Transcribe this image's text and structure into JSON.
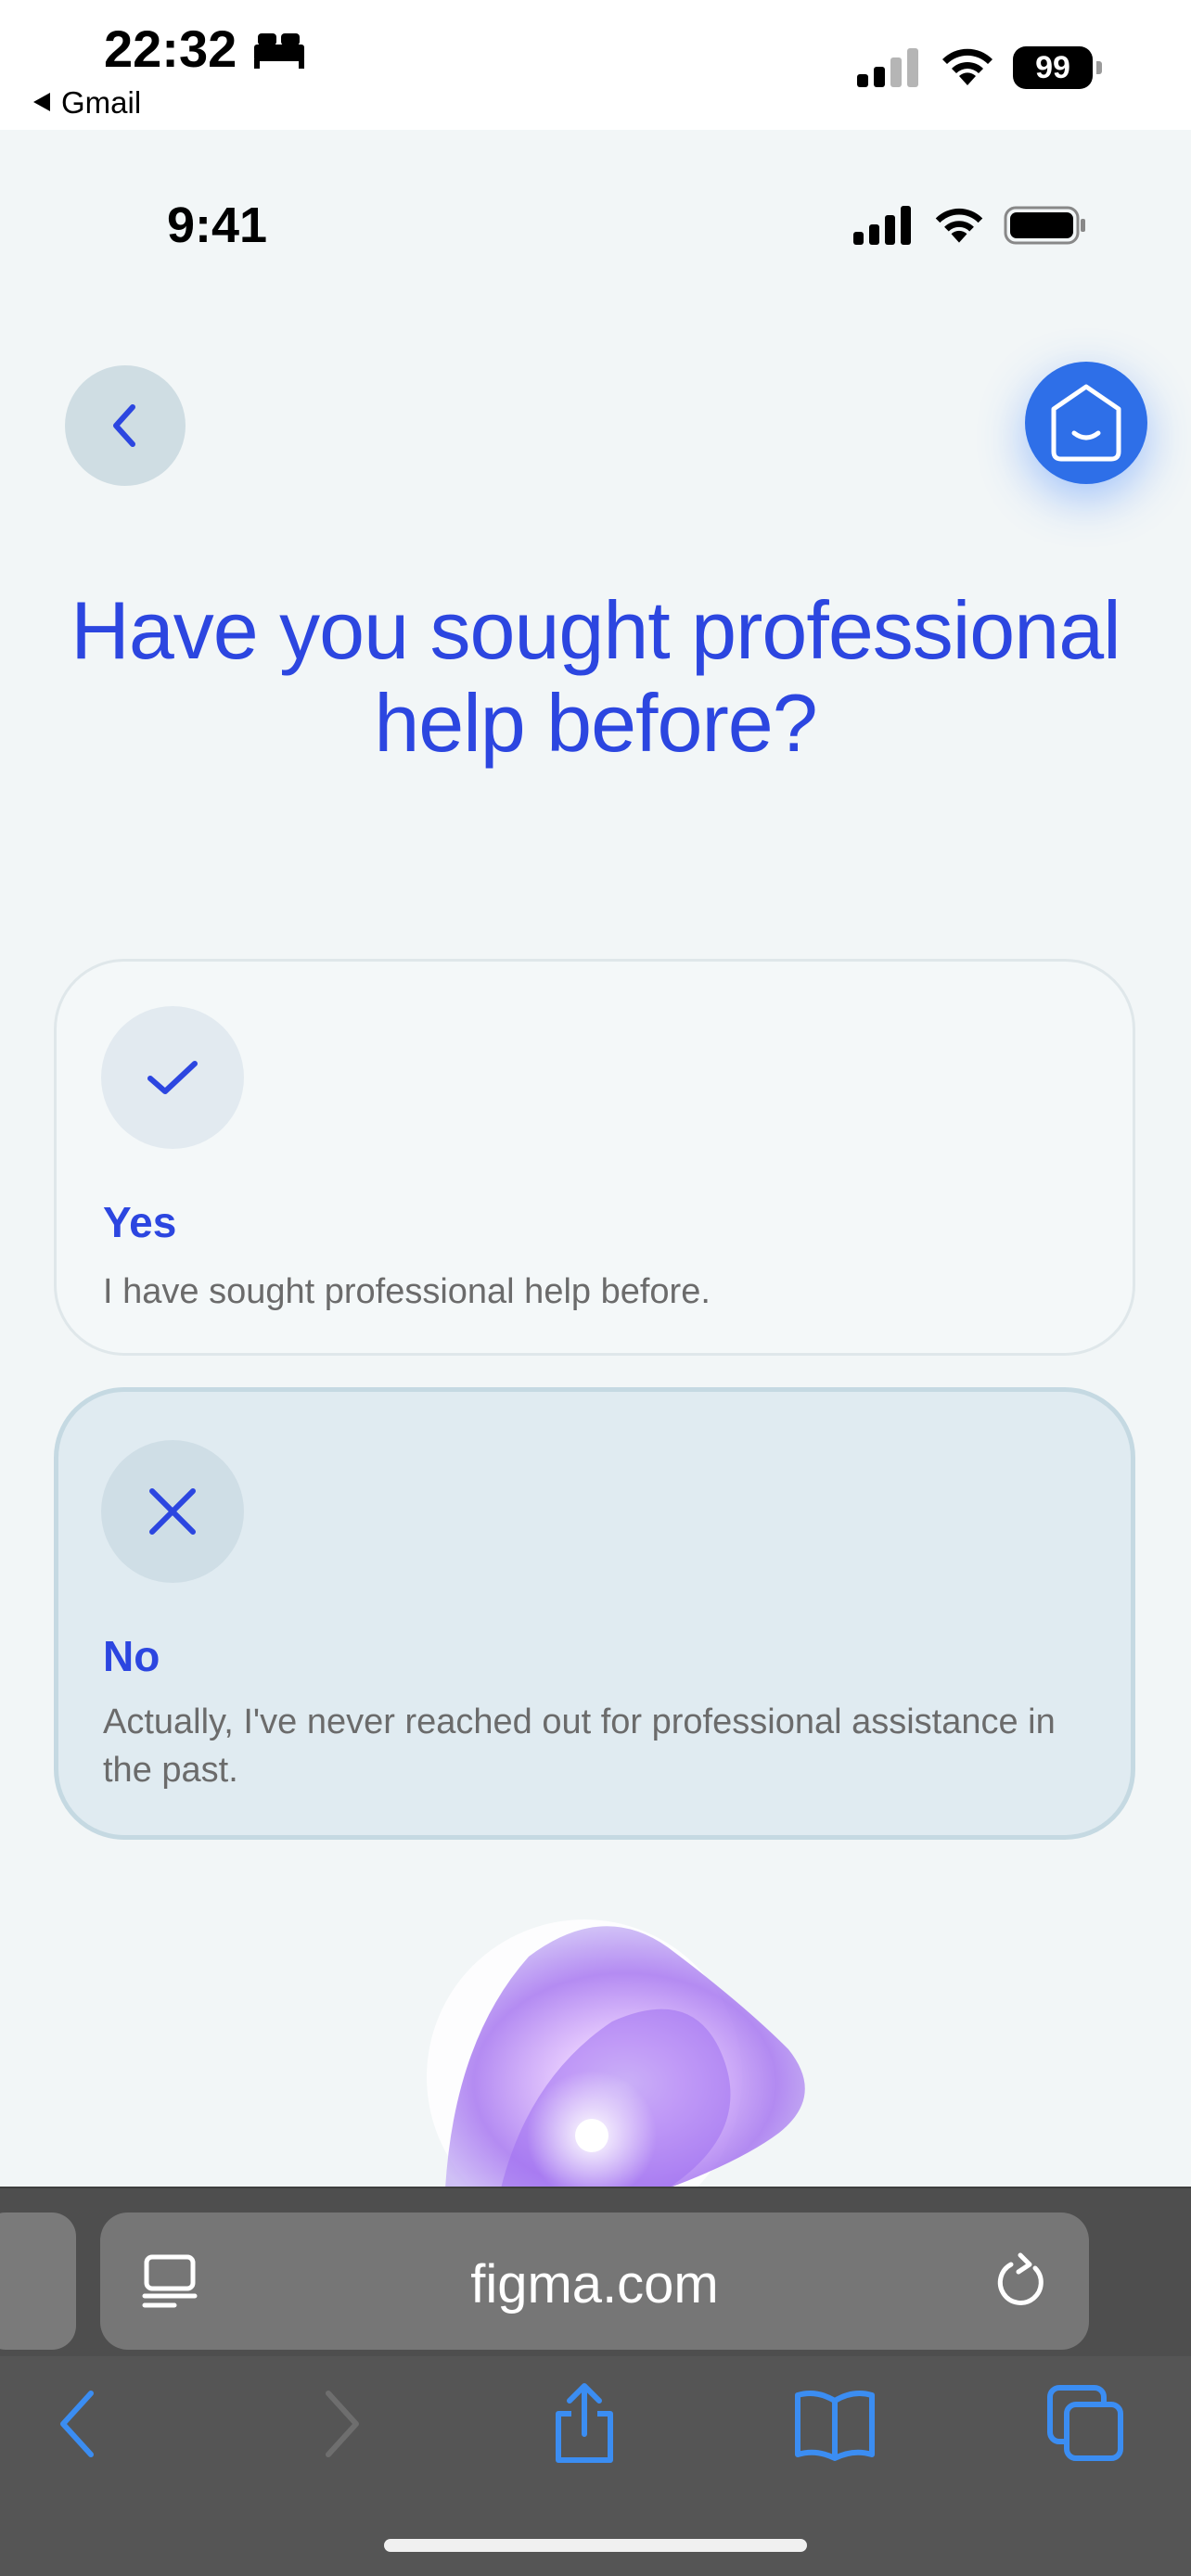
{
  "outer_status": {
    "time": "22:32",
    "back_app": "Gmail",
    "battery": "99"
  },
  "inner_status": {
    "time": "9:41"
  },
  "question": {
    "title": "Have you sought professional help before?"
  },
  "options": [
    {
      "title": "Yes",
      "description": "I have sought professional help before.",
      "icon": "check-icon",
      "selected": false
    },
    {
      "title": "No",
      "description": "Actually, I've never reached out for professional assistance in the past.",
      "icon": "x-icon",
      "selected": true
    }
  ],
  "browser": {
    "url": "figma.com"
  },
  "colors": {
    "accent": "#2c46e0",
    "home_button": "#2e6fe8",
    "background": "#f2f6f7"
  }
}
